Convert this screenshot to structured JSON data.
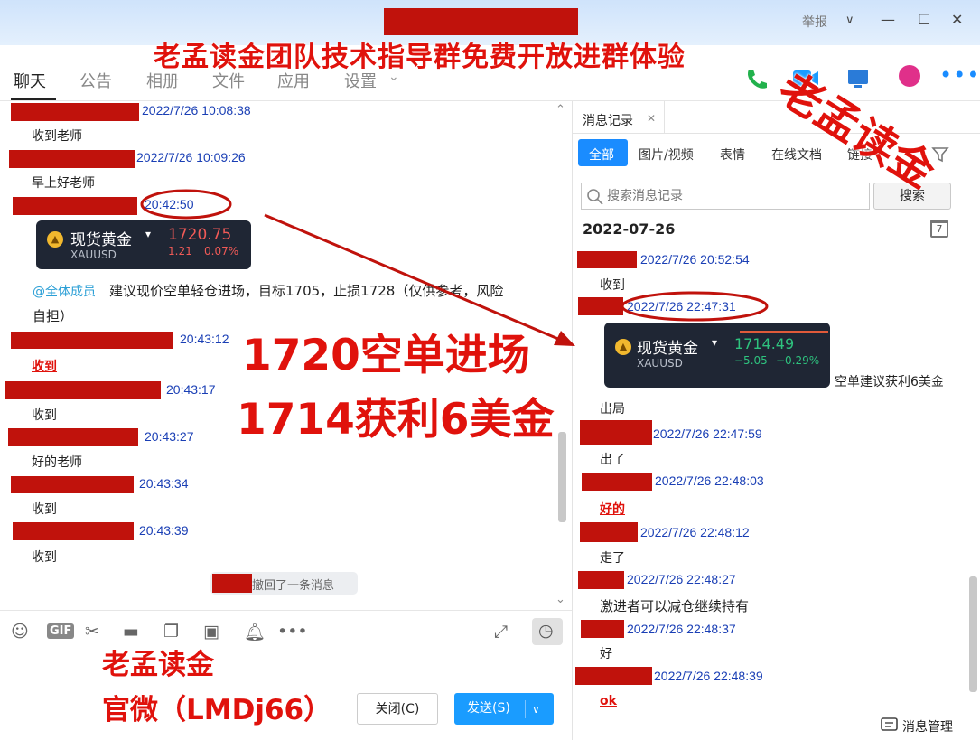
{
  "window": {
    "report_label": "举报",
    "minimize_glyph": "—",
    "maximize_glyph": "☐",
    "close_glyph": "✕",
    "caret_glyph": "∨"
  },
  "tabs": [
    {
      "label": "聊天"
    },
    {
      "label": "公告"
    },
    {
      "label": "相册"
    },
    {
      "label": "文件"
    },
    {
      "label": "应用"
    },
    {
      "label": "设置"
    }
  ],
  "overlays": {
    "banner": "老孟读金团队技术指导群免费开放进群体验",
    "brand_corner": "老孟读金",
    "trade_line1": "1720空单进场",
    "trade_line2": "1714获利6美金",
    "contact_line1": "老孟读金",
    "contact_line2": "官微（LMDj66）"
  },
  "chat": {
    "messages": [
      {
        "time": "2022/7/26 10:08:38",
        "text": "收到老师"
      },
      {
        "time": "2022/7/26 10:09:26",
        "text": "早上好老师"
      },
      {
        "time": "20:42:50"
      },
      {
        "time": "20:43:12",
        "text": "收到"
      },
      {
        "time": "20:43:17",
        "text": "收到"
      },
      {
        "time": "20:43:27",
        "text": "好的老师"
      },
      {
        "time": "20:43:34",
        "text": "收到"
      },
      {
        "time": "20:43:39",
        "text": "收到"
      }
    ],
    "gold_card": {
      "name": "现货黄金",
      "symbol": "XAUUSD",
      "price": "1720.75",
      "change": "1.21",
      "change_pct": "0.07%"
    },
    "mention": "@全体成员",
    "advice_line1": "建议现价空单轻仓进场，目标1705，止损1728（仅供参考，风险",
    "advice_line2": "自担）",
    "recall_notice": "撤回了一条消息"
  },
  "toolbar": {
    "gif_label": "GIF"
  },
  "buttons": {
    "close": "关闭(C)",
    "send": "发送(S)",
    "send_caret": "∨"
  },
  "history": {
    "tab_label": "消息记录",
    "filters": [
      "全部",
      "图片/视频",
      "表情",
      "在线文档",
      "链接"
    ],
    "search_placeholder": "搜索消息记录",
    "search_button": "搜索",
    "date": "2022-07-26",
    "calendar_day": "7",
    "messages": [
      {
        "time": "2022/7/26 20:52:54",
        "text": "收到"
      },
      {
        "time": "2022/7/26 22:47:31",
        "text": "空单建议获利6美金",
        "text2": "出局"
      },
      {
        "time": "2022/7/26 22:47:59",
        "text": "出了"
      },
      {
        "time": "2022/7/26 22:48:03",
        "text": "好的"
      },
      {
        "time": "2022/7/26 22:48:12",
        "text": "走了"
      },
      {
        "time": "2022/7/26 22:48:27",
        "text": "激进者可以减仓继续持有"
      },
      {
        "time": "2022/7/26 22:48:37",
        "text": "好"
      },
      {
        "time": "2022/7/26 22:48:39",
        "text": "ok"
      }
    ],
    "gold_card": {
      "name": "现货黄金",
      "symbol": "XAUUSD",
      "price": "1714.49",
      "change": "−5.05",
      "change_pct": "−0.29%"
    },
    "manage_label": "消息管理"
  },
  "colors": {
    "accent": "#1a8cff",
    "redact": "#c0120c",
    "overlay_red": "#e0120c",
    "time_blue": "#1a3fb5"
  }
}
